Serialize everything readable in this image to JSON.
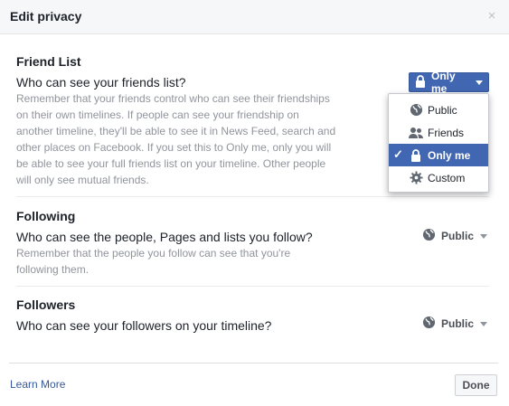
{
  "dialog": {
    "title": "Edit privacy",
    "close_glyph": "×"
  },
  "friend_list": {
    "title": "Friend List",
    "question": "Who can see your friends list?",
    "description": "Remember that your friends control who can see their friendships on their own timelines. If people can see your friendship on another timeline, they'll be able to see it in News Feed, search and other places on Facebook. If you set this to Only me, only you will be able to see your full friends list on your timeline. Other people will only see mutual friends.",
    "setting": "Only me",
    "setting_icon": "lock-icon"
  },
  "dropdown": {
    "items": [
      {
        "label": "Public",
        "icon": "globe-icon",
        "selected": false
      },
      {
        "label": "Friends",
        "icon": "friends-icon",
        "selected": false
      },
      {
        "label": "Only me",
        "icon": "lock-icon",
        "selected": true
      },
      {
        "label": "Custom",
        "icon": "gear-icon",
        "selected": false
      }
    ]
  },
  "following": {
    "title": "Following",
    "question": "Who can see the people, Pages and lists you follow?",
    "description": "Remember that the people you follow can see that you're following them.",
    "setting": "Public",
    "setting_icon": "globe-icon"
  },
  "followers": {
    "title": "Followers",
    "question": "Who can see your followers on your timeline?",
    "setting": "Public",
    "setting_icon": "globe-icon"
  },
  "footer": {
    "learn_more": "Learn More",
    "done": "Done"
  },
  "colors": {
    "accent": "#4267b2",
    "link": "#365899",
    "muted": "#90949c",
    "header_bg": "#f6f7f9"
  }
}
